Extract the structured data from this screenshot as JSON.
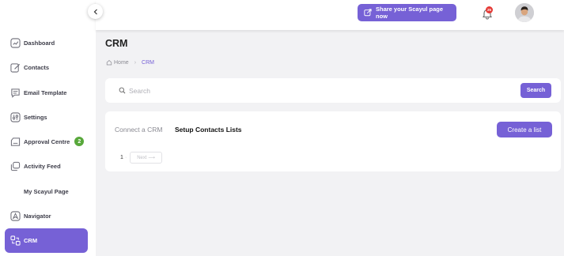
{
  "sidebar": {
    "items": [
      {
        "label": "Dashboard",
        "icon": "dashboard-icon",
        "active": false
      },
      {
        "label": "Contacts",
        "icon": "contacts-icon",
        "active": false
      },
      {
        "label": "Email Template",
        "icon": "email-template-icon",
        "active": false
      },
      {
        "label": "Settings",
        "icon": "settings-icon",
        "active": false
      },
      {
        "label": "Approval Centre",
        "icon": "approval-centre-icon",
        "active": false,
        "badge": "2"
      },
      {
        "label": "Activity Feed",
        "icon": "activity-feed-icon",
        "active": false
      },
      {
        "label": "My Scayul Page",
        "icon": "",
        "active": false
      },
      {
        "label": "Navigator",
        "icon": "navigator-icon",
        "active": false
      },
      {
        "label": "CRM",
        "icon": "crm-icon",
        "active": true
      }
    ]
  },
  "header": {
    "share_label": "Share your Scayul page now",
    "notification_count": "25"
  },
  "page": {
    "title": "CRM",
    "breadcrumb": {
      "home": "Home",
      "current": "CRM"
    }
  },
  "search": {
    "placeholder": "Search",
    "value": "",
    "button_label": "Search"
  },
  "lists": {
    "tabs": [
      {
        "label": "Connect a CRM",
        "active": false
      },
      {
        "label": "Setup Contacts Lists",
        "active": true
      }
    ],
    "create_label": "Create a list",
    "pagination": {
      "current_page": "1",
      "next_label": "Next ⟶"
    }
  },
  "colors": {
    "accent": "#7661d6",
    "badge_green": "#58a83b",
    "notification_red": "#e53935",
    "background": "#f2f2f4"
  }
}
